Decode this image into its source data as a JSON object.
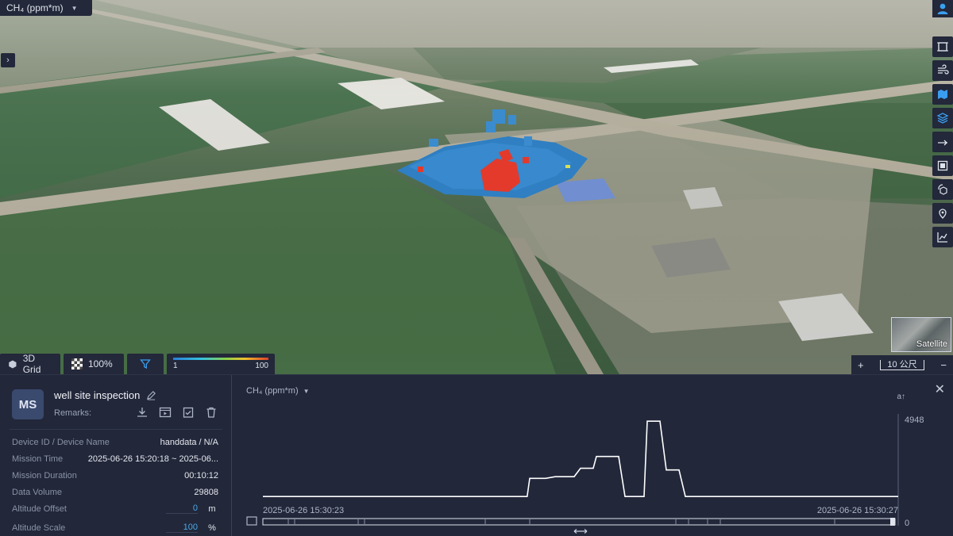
{
  "map": {
    "metric": "CH₄ (ppm*m)",
    "satellite_label": "Satellite",
    "controls": {
      "grid_label": "3D Grid",
      "opacity_label": "100%",
      "legend_min": "1",
      "legend_max": "100"
    },
    "scale_label": "10 公尺",
    "zoom_in": "+",
    "zoom_out": "−",
    "toolbar_icons": [
      "crop-icon",
      "wind-icon",
      "layers-map-icon",
      "stack-icon",
      "measure-icon",
      "square-icon",
      "rotate-cube-icon",
      "location-pin-icon",
      "chart-line-icon"
    ]
  },
  "panel": {
    "avatar": "MS",
    "title": "well site inspection",
    "remarks_label": "Remarks:",
    "rows": [
      {
        "key": "Device ID / Device Name",
        "value": "handdata / N/A"
      },
      {
        "key": "Mission Time",
        "value": "2025-06-26 15:20:18 ~ 2025-06..."
      },
      {
        "key": "Mission Duration",
        "value": "00:10:12"
      },
      {
        "key": "Data Volume",
        "value": "29808"
      }
    ],
    "altitude_offset": {
      "label": "Altitude Offset",
      "value": "0",
      "unit": "m"
    },
    "altitude_scale": {
      "label": "Altitude Scale",
      "value": "100",
      "unit": "%"
    },
    "chart_metric": "CH₄ (ppm*m)",
    "close": "✕",
    "ai_icon": "a↑"
  },
  "chart_data": {
    "type": "line",
    "x_start_label": "2025-06-26 15:30:23",
    "x_end_label": "2025-06-26 15:30:27",
    "ylim": [
      0,
      4948
    ],
    "y_ticks": [
      "4948",
      "0"
    ],
    "x": [
      0,
      0.416,
      0.42,
      0.445,
      0.46,
      0.49,
      0.5,
      0.52,
      0.525,
      0.56,
      0.57,
      0.6,
      0.605,
      0.625,
      0.635,
      0.655,
      0.665,
      0.7,
      0.71,
      1
    ],
    "values": [
      320,
      320,
      1400,
      1400,
      1500,
      1500,
      2000,
      2000,
      2700,
      2700,
      320,
      320,
      4800,
      4800,
      1900,
      1900,
      320,
      320,
      320,
      320
    ]
  }
}
